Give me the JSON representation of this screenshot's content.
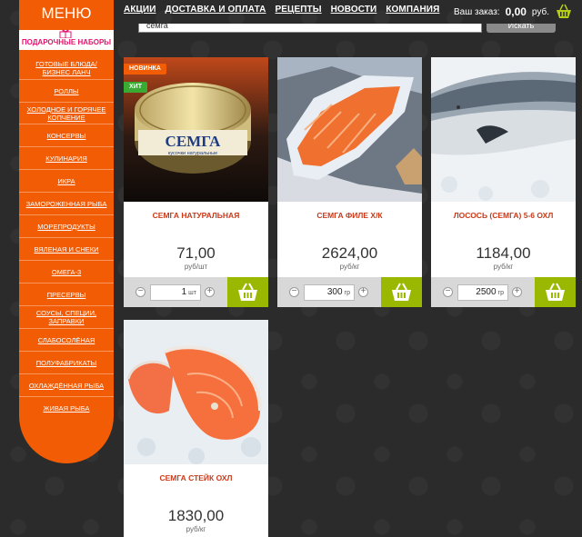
{
  "nav": {
    "items": [
      "АКЦИИ",
      "ДОСТАВКА И ОПЛАТА",
      "РЕЦЕПТЫ",
      "НОВОСТИ",
      "КОМПАНИЯ"
    ]
  },
  "order": {
    "label": "Ваш заказ:",
    "value": "0,00",
    "currency": "руб."
  },
  "search": {
    "value": "семга",
    "button_label": "Искать"
  },
  "sidebar": {
    "title": "МЕНЮ",
    "gift_label": "ПОДАРОЧНЫЕ НАБОРЫ",
    "items": [
      "ГОТОВЫЕ БЛЮДА/БИЗНЕС ЛАНЧ",
      "РОЛЛЫ",
      "ХОЛОДНОЕ И ГОРЯЧЕЕ КОПЧЕНИЕ",
      "КОНСЕРВЫ",
      "КУЛИНАРИЯ",
      "ИКРА",
      "ЗАМОРОЖЕННАЯ РЫБА",
      "МОРЕПРОДУКТЫ",
      "ВЯЛЕНАЯ И СНЕКИ",
      "ОМЕГА-3",
      "ПРЕСЕРВЫ",
      "СОУСЫ, СПЕЦИИ, ЗАПРАВКИ",
      "СЛАБОСОЛЁНАЯ",
      "ПОЛУФАБРИКАТЫ",
      "ОХЛАЖДЁННАЯ РЫБА",
      "ЖИВАЯ РЫБА"
    ]
  },
  "products": [
    {
      "name": "СЕМГА НАТУРАЛЬНАЯ",
      "price": "71,00",
      "unit": "руб/шт",
      "qty": "1",
      "qty_unit": "шт",
      "badges": [
        "НОВИНКА",
        "ХИТ"
      ],
      "can_label": "СЕМГА",
      "can_sub": "кусочки натуральные"
    },
    {
      "name": "СЕМГА ФИЛЕ Х/К",
      "price": "2624,00",
      "unit": "руб/кг",
      "qty": "300",
      "qty_unit": "гр"
    },
    {
      "name": "ЛОСОСЬ (СЕМГА) 5-6 ОХЛ",
      "price": "1184,00",
      "unit": "руб/кг",
      "qty": "2500",
      "qty_unit": "гр"
    },
    {
      "name": "СЕМГА СТЕЙК ОХЛ",
      "price": "1830,00",
      "unit": "руб/кг"
    }
  ],
  "colors": {
    "accent": "#f25c05",
    "buy": "#9bb800",
    "name": "#c83a1a",
    "badge_new": "#f25c05",
    "badge_hit": "#3aaa35"
  }
}
